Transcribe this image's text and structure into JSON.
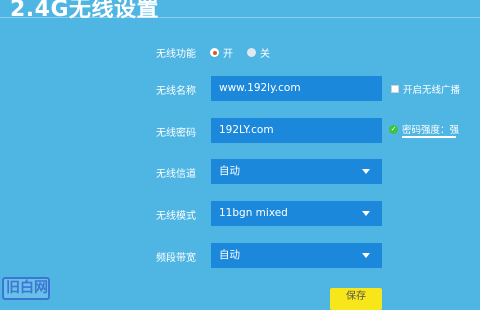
{
  "page": {
    "title": "2.4G无线设置"
  },
  "form": {
    "wireless_function": {
      "label": "无线功能",
      "option_on": "开",
      "option_off": "关",
      "selected": "开"
    },
    "ssid": {
      "label": "无线名称",
      "value": "www.192ly.com",
      "hide_broadcast_label": "开启无线广播",
      "hide_broadcast_checked": false
    },
    "password": {
      "label": "无线密码",
      "value": "192LY.com",
      "strength_text": "密码强度：强"
    },
    "channel": {
      "label": "无线信道",
      "value": "自动"
    },
    "mode": {
      "label": "无线模式",
      "value": "11bgn mixed"
    },
    "bandwidth": {
      "label": "频段带宽",
      "value": "自动"
    }
  },
  "actions": {
    "save_label": "保存"
  },
  "watermark": {
    "text": "旧白网"
  },
  "colors": {
    "background": "#4fb6e4",
    "field": "#1b88dc",
    "save_button": "#f6e61a",
    "strength_ok": "#3ec33e"
  }
}
